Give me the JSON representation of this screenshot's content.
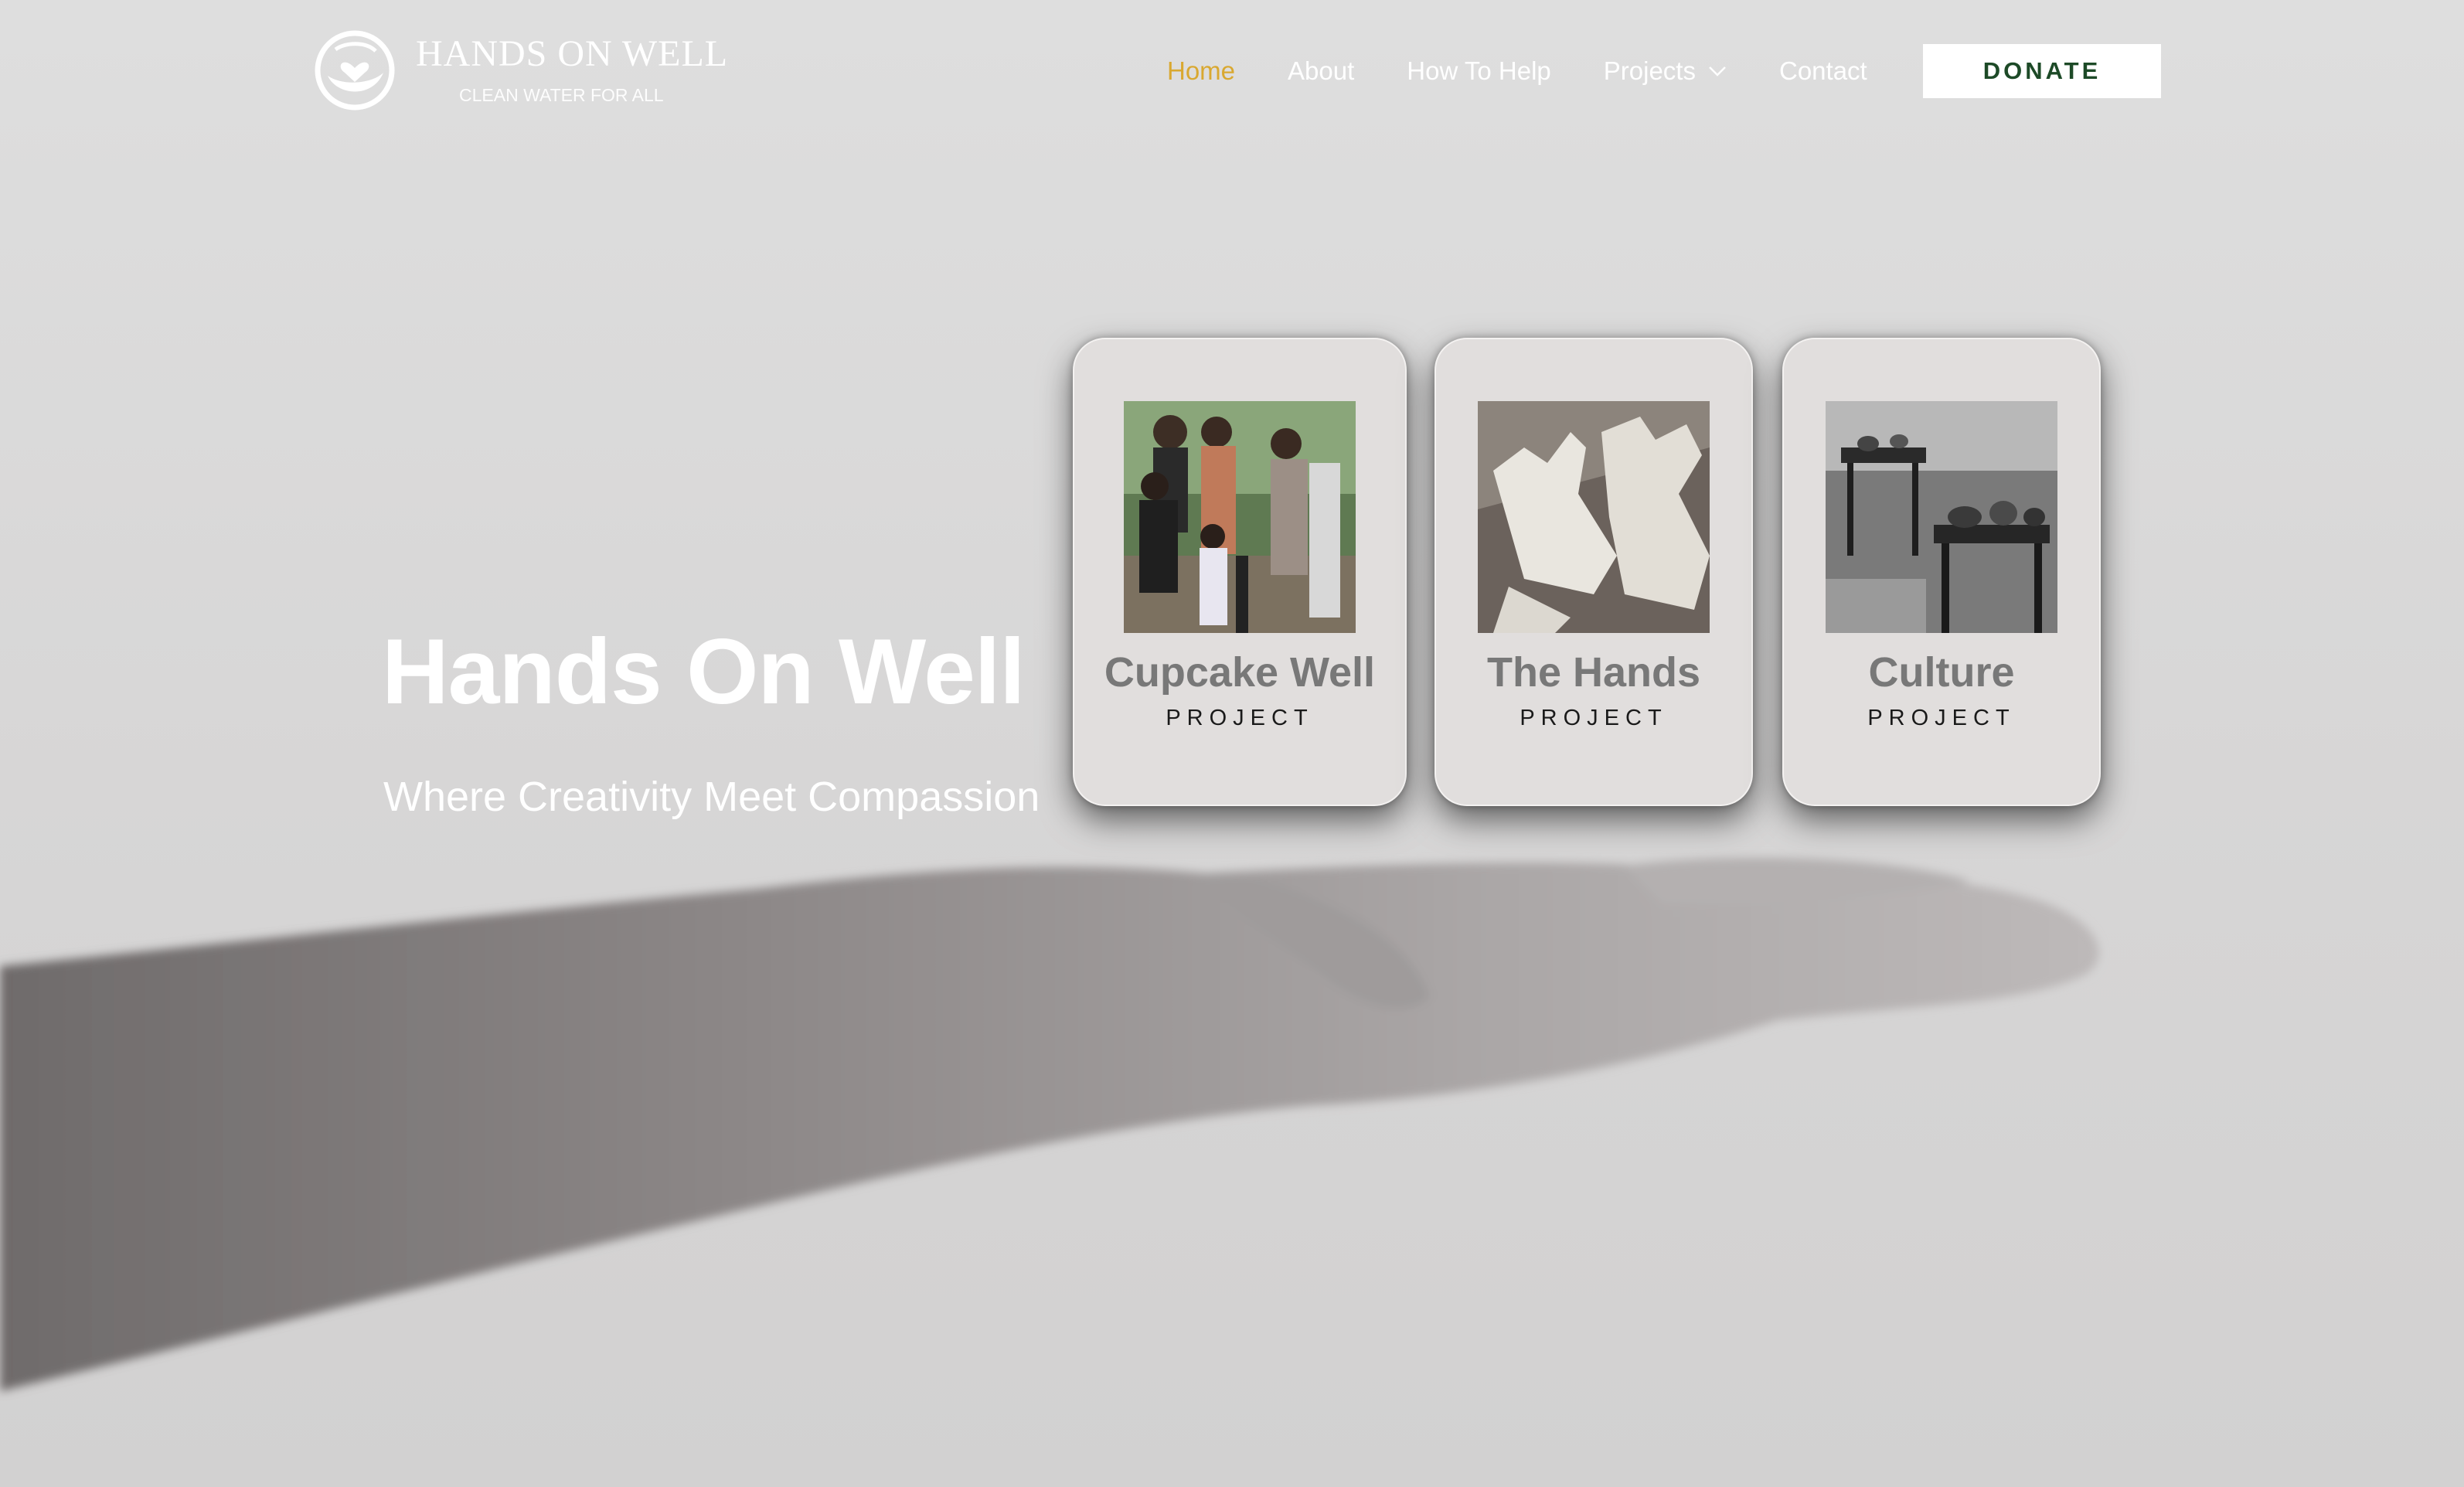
{
  "brand": {
    "name": "HANDS ON WELL",
    "tagline": "CLEAN WATER FOR ALL",
    "logo_icon": "globe-heart-icon"
  },
  "nav": {
    "items": [
      {
        "label": "Home",
        "active": true
      },
      {
        "label": "About"
      },
      {
        "label": "How To Help"
      },
      {
        "label": "Projects",
        "has_dropdown": true
      },
      {
        "label": "Contact"
      }
    ],
    "donate_label": "DONATE"
  },
  "hero": {
    "title": "Hands On Well",
    "subtitle": "Where Creativity Meet Compassion"
  },
  "projects": [
    {
      "title": "Cupcake Well",
      "label": "PROJECT",
      "image": "family-at-well-photo"
    },
    {
      "title": "The Hands",
      "label": "PROJECT",
      "image": "gloved-hands-photo"
    },
    {
      "title": "Culture",
      "label": "PROJECT",
      "image": "pottery-table-photo"
    }
  ],
  "colors": {
    "nav_active": "#d9a830",
    "donate_text": "#1d4a27",
    "card_bg": "#e1dedd",
    "card_title": "#787878"
  }
}
